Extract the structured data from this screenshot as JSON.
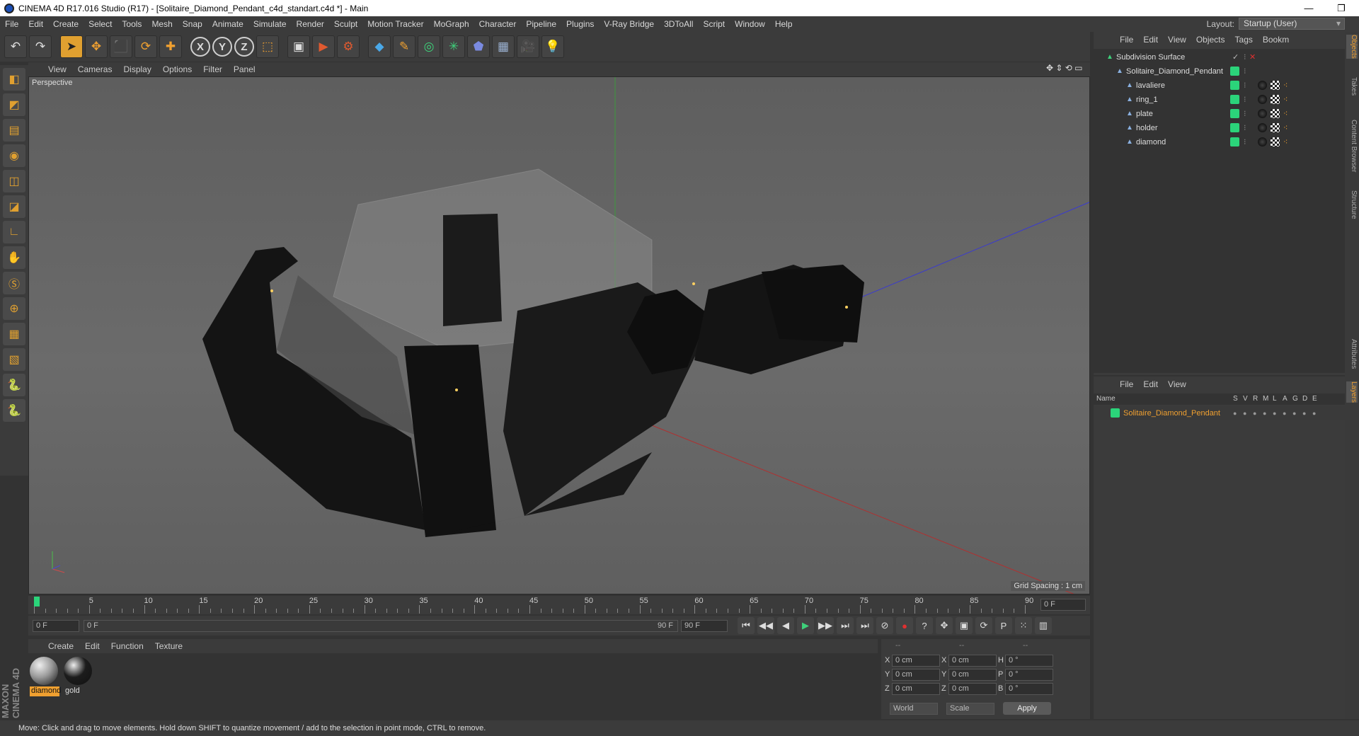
{
  "title": "CINEMA 4D R17.016 Studio (R17) - [Solitaire_Diamond_Pendant_c4d_standart.c4d *] - Main",
  "window_controls": {
    "minimize": "—",
    "maximize": "❐",
    "close": "✕"
  },
  "menu": [
    "File",
    "Edit",
    "Create",
    "Select",
    "Tools",
    "Mesh",
    "Snap",
    "Animate",
    "Simulate",
    "Render",
    "Sculpt",
    "Motion Tracker",
    "MoGraph",
    "Character",
    "Pipeline",
    "Plugins",
    "V-Ray Bridge",
    "3DToAll",
    "Script",
    "Window",
    "Help"
  ],
  "layout": {
    "label": "Layout:",
    "value": "Startup (User)"
  },
  "toolbar": {
    "undo": "↶",
    "redo": "↷",
    "select": "➤",
    "move": "✥",
    "scale": "⬛",
    "rotate": "⟳",
    "last_tool": "✚",
    "axis_x": "X",
    "axis_y": "Y",
    "axis_z": "Z",
    "coord_system": "⬚",
    "render_view": "▣",
    "render_pv": "▶",
    "render_settings": "⚙",
    "cube": "◆",
    "spline": "✎",
    "nurbs": "◎",
    "array": "✳",
    "deformer": "⬟",
    "scene": "▦",
    "camera": "🎥",
    "light": "💡"
  },
  "left_tools": [
    "◧",
    "◩",
    "▤",
    "◉",
    "◫",
    "◪",
    "∟",
    "✋",
    "Ⓢ",
    "⊕",
    "▦",
    "▧",
    "🐍",
    "🐍"
  ],
  "viewport_menu": [
    "View",
    "Cameras",
    "Display",
    "Options",
    "Filter",
    "Panel"
  ],
  "viewport": {
    "label": "Perspective",
    "grid_spacing": "Grid Spacing : 1 cm",
    "nav_icons": "✥ ⇕ ⟲ ▭"
  },
  "timeline": {
    "ticks": [
      "0",
      "5",
      "10",
      "15",
      "20",
      "25",
      "30",
      "35",
      "40",
      "45",
      "50",
      "55",
      "60",
      "65",
      "70",
      "75",
      "80",
      "85",
      "90"
    ],
    "end_field": "0 F"
  },
  "animation": {
    "current": "0 F",
    "range_start": "0 F",
    "range_end_inner": "90 F",
    "range_end": "90 F"
  },
  "playback_icons": [
    "⏮",
    "◀◀",
    "◀",
    "▶",
    "▶▶",
    "⏭",
    "⏭",
    "⊘",
    "●",
    "?",
    "✥",
    "▣",
    "⟳",
    "P",
    "⁙",
    "▥"
  ],
  "material_menu": [
    "Create",
    "Edit",
    "Function",
    "Texture"
  ],
  "materials": [
    {
      "name": "diamond",
      "color": "#9a9a9a",
      "selected": true
    },
    {
      "name": "gold",
      "color": "#1c1c1c",
      "selected": false
    }
  ],
  "coords": {
    "header": [
      "--",
      "--",
      "--"
    ],
    "rows": [
      {
        "a": "X",
        "av": "0 cm",
        "b": "X",
        "bv": "0 cm",
        "c": "H",
        "cv": "0 °"
      },
      {
        "a": "Y",
        "av": "0 cm",
        "b": "Y",
        "bv": "0 cm",
        "c": "P",
        "cv": "0 °"
      },
      {
        "a": "Z",
        "av": "0 cm",
        "b": "Z",
        "bv": "0 cm",
        "c": "B",
        "cv": "0 °"
      }
    ],
    "world": "World",
    "scale": "Scale",
    "apply": "Apply"
  },
  "objects_menu": [
    "File",
    "Edit",
    "View",
    "Objects",
    "Tags",
    "Bookm"
  ],
  "objects": [
    {
      "name": "Subdivision Surface",
      "indent": 0
    },
    {
      "name": "Solitaire_Diamond_Pendant",
      "indent": 1
    },
    {
      "name": "lavaliere",
      "indent": 2
    },
    {
      "name": "ring_1",
      "indent": 2
    },
    {
      "name": "plate",
      "indent": 2
    },
    {
      "name": "holder",
      "indent": 2
    },
    {
      "name": "diamond",
      "indent": 2
    }
  ],
  "layers_menu": [
    "File",
    "Edit",
    "View"
  ],
  "layers_header": {
    "name": "Name",
    "cols": [
      "S",
      "V",
      "R",
      "M",
      "L",
      "A",
      "G",
      "D",
      "E"
    ]
  },
  "layers": [
    {
      "name": "Solitaire_Diamond_Pendant"
    }
  ],
  "side_tabs": [
    "Objects",
    "Takes",
    "Content Browser",
    "Structure",
    "Attributes",
    "Layers"
  ],
  "maxon": "MAXON CINEMA 4D",
  "status": "Move: Click and drag to move elements. Hold down SHIFT to quantize movement / add to the selection in point mode, CTRL to remove.",
  "colors": {
    "accent": "#f0a030",
    "layer_green": "#2bd47a",
    "selected_text": "#f0a030"
  }
}
